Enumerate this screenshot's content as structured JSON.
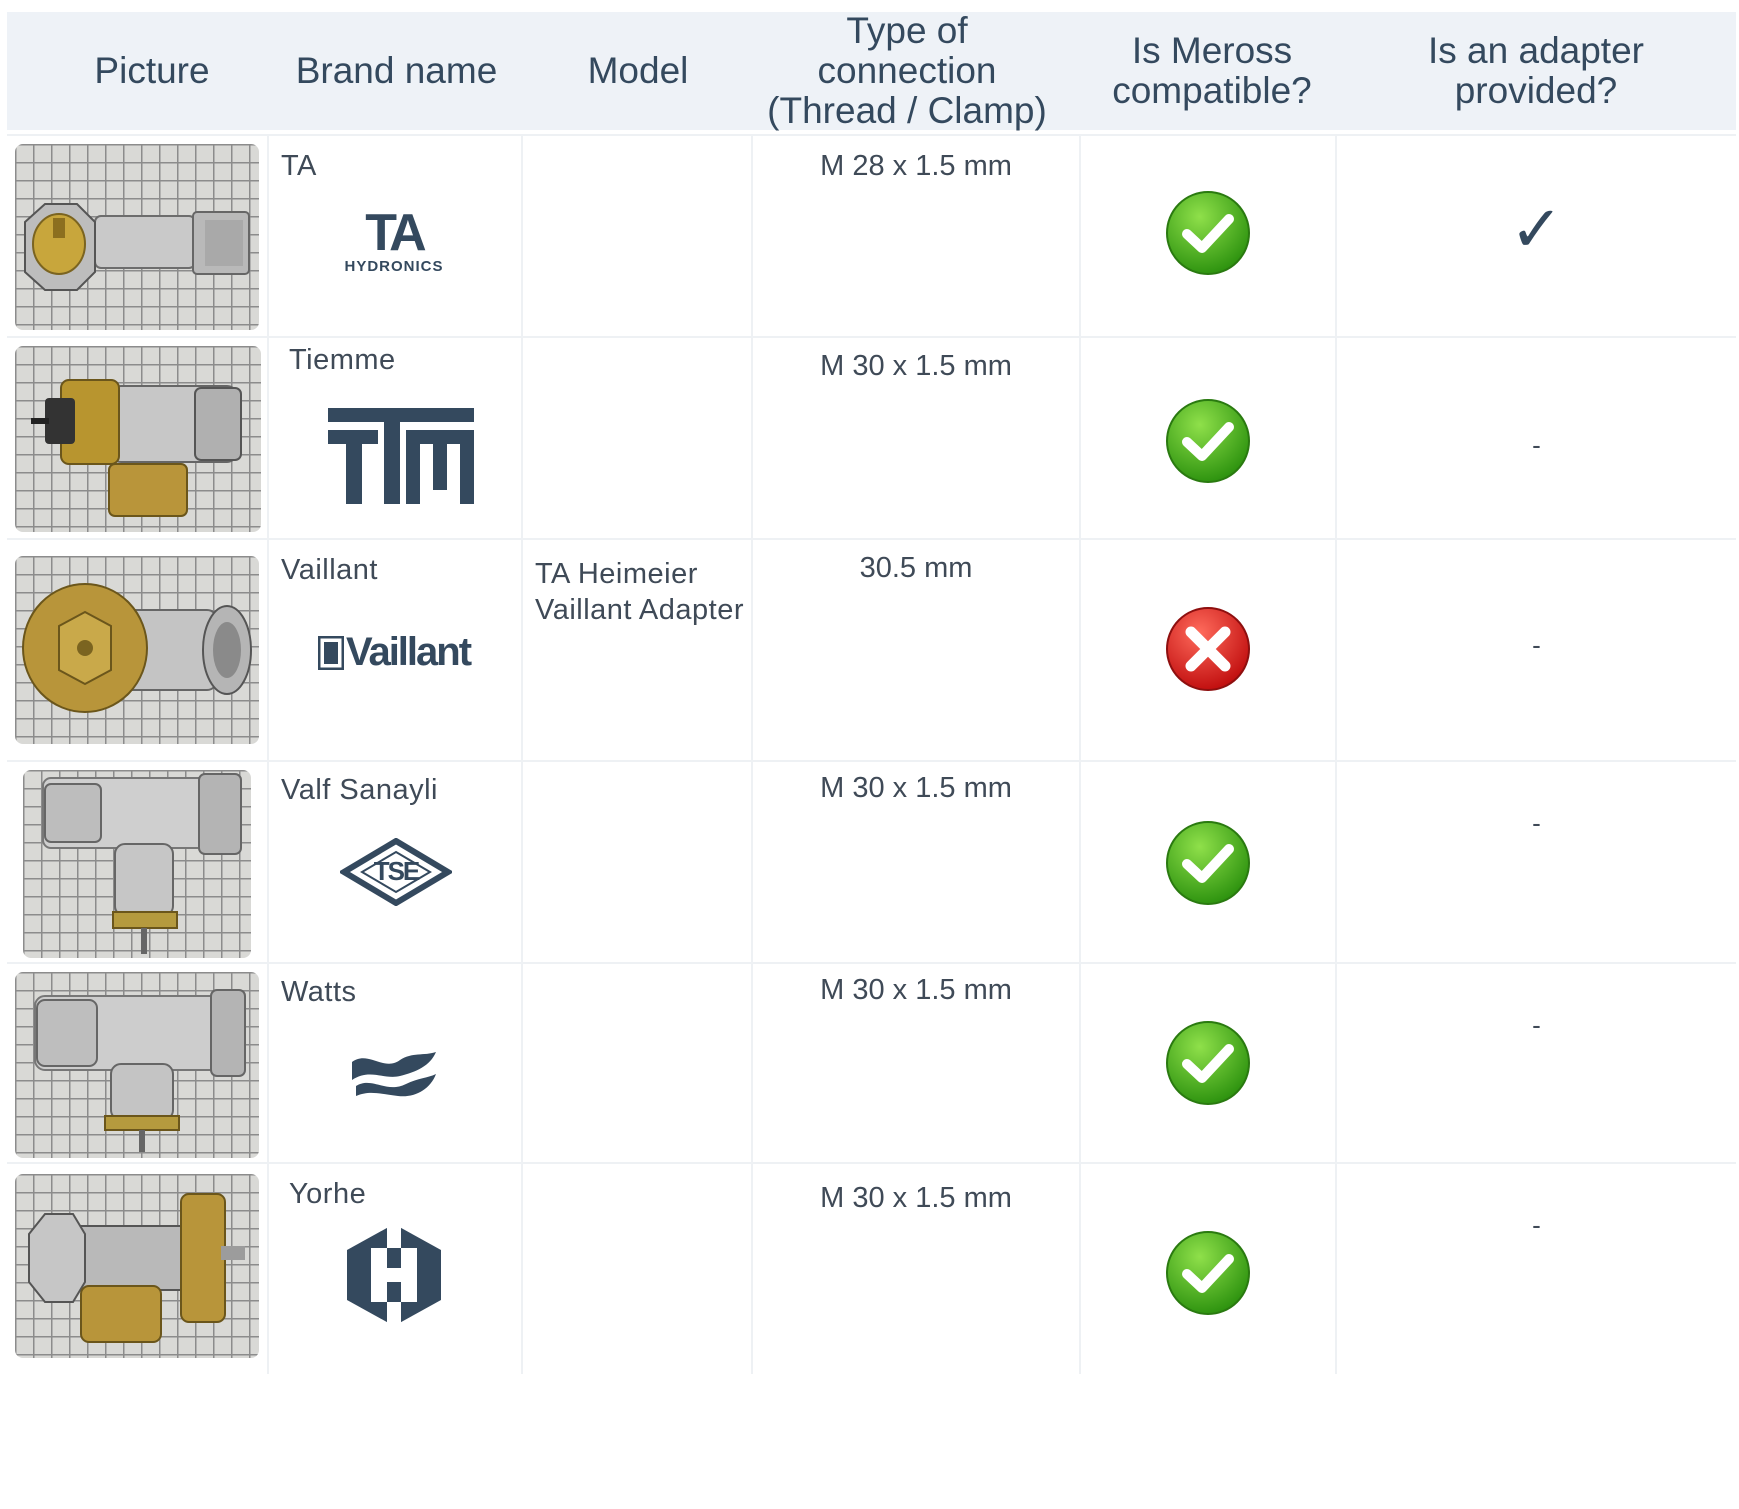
{
  "headers": {
    "picture": "Picture",
    "brand": "Brand name",
    "model": "Model",
    "connection_line1": "Type of connection",
    "connection_line2": "(Thread / Clamp)",
    "compatible_line1": "Is Meross",
    "compatible_line2": "compatible?",
    "adapter_line1": "Is an adapter",
    "adapter_line2": "provided?"
  },
  "colors": {
    "header_bg": "#eef2f7",
    "logo": "#34495e",
    "check_green": "#4cb71a",
    "cross_red": "#e02626"
  },
  "rows": [
    {
      "brand": "TA",
      "logo_icon": "ta-hydronics-logo",
      "logo_text": "TA",
      "logo_subtext": "HYDRONICS",
      "model_line1": "",
      "model_line2": "",
      "connection": "M 28 x 1.5 mm",
      "compatible": "yes",
      "adapter": "✓"
    },
    {
      "brand": "Tiemme",
      "logo_icon": "ttm-logo",
      "logo_text": "TTM",
      "logo_subtext": "",
      "model_line1": "",
      "model_line2": "",
      "connection": "M 30 x 1.5 mm",
      "compatible": "yes",
      "adapter": "-"
    },
    {
      "brand": "Vaillant",
      "logo_icon": "vaillant-logo",
      "logo_text": "Vaillant",
      "logo_subtext": "",
      "model_line1": "TA Heimeier",
      "model_line2": "Vaillant Adapter",
      "connection": "30.5 mm",
      "compatible": "no",
      "adapter": "-"
    },
    {
      "brand": "Valf Sanayli",
      "logo_icon": "tse-logo",
      "logo_text": "TSE",
      "logo_subtext": "",
      "model_line1": "",
      "model_line2": "",
      "connection": "M 30 x 1.5 mm",
      "compatible": "yes",
      "adapter": "-"
    },
    {
      "brand": "Watts",
      "logo_icon": "watts-logo",
      "logo_text": "",
      "logo_subtext": "",
      "model_line1": "",
      "model_line2": "",
      "connection": "M 30 x 1.5 mm",
      "compatible": "yes",
      "adapter": "-"
    },
    {
      "brand": "Yorhe",
      "logo_icon": "yorhe-logo",
      "logo_text": "",
      "logo_subtext": "",
      "model_line1": "",
      "model_line2": "",
      "connection": "M 30 x 1.5 mm",
      "compatible": "yes",
      "adapter": "-"
    }
  ]
}
